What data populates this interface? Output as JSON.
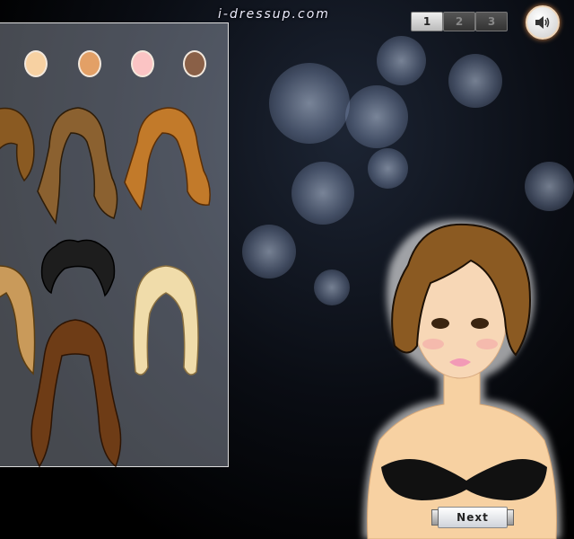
{
  "site": {
    "logo_text": "i-dressup.com"
  },
  "pages": [
    {
      "label": "1",
      "active": true
    },
    {
      "label": "2",
      "active": false
    },
    {
      "label": "3",
      "active": false
    }
  ],
  "sound_button": {
    "icon": "speaker-icon"
  },
  "skin_swatches": [
    "#f7d1a2",
    "#e3a066",
    "#fbc4c4",
    "#8a6047"
  ],
  "hairstyles": [
    "auburn-side",
    "brown-wavy-long",
    "copper-wavy",
    "blonde-straight-side",
    "black-short-messy",
    "platinum-bob",
    "brown-wavy-bangs-long"
  ],
  "buttons": {
    "next_label": "Next"
  }
}
